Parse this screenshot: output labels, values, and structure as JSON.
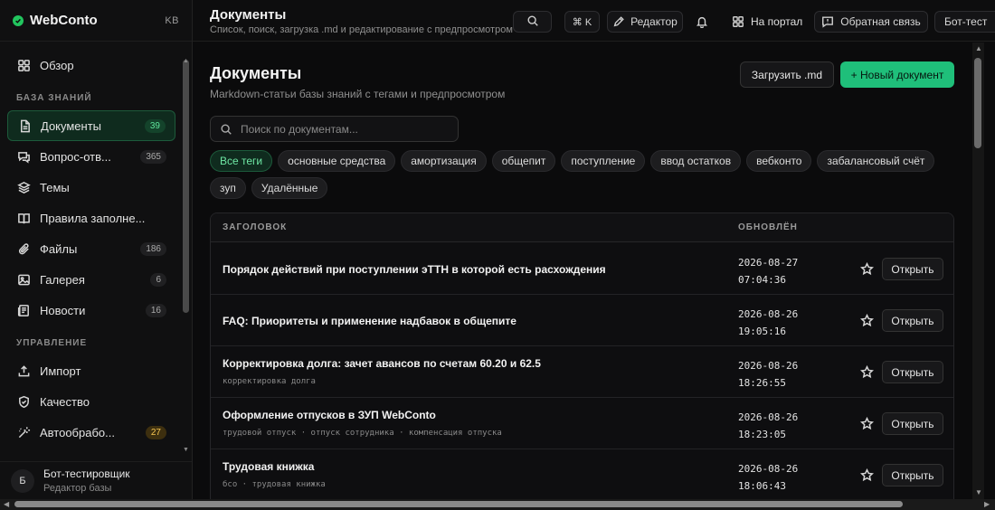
{
  "brand": {
    "name": "WebConto",
    "kb": "KB"
  },
  "sidebar": {
    "top": [
      {
        "label": "Обзор",
        "icon": "grid-icon"
      }
    ],
    "section_knowledge": "БАЗА ЗНАНИЙ",
    "knowledge": [
      {
        "label": "Документы",
        "badge": "39",
        "icon": "document-icon"
      },
      {
        "label": "Вопрос-отв...",
        "badge": "365",
        "icon": "chat-icon"
      },
      {
        "label": "Темы",
        "badge": "",
        "icon": "layers-icon"
      },
      {
        "label": "Правила заполне...",
        "badge": "",
        "icon": "book-icon"
      },
      {
        "label": "Файлы",
        "badge": "186",
        "icon": "paperclip-icon"
      },
      {
        "label": "Галерея",
        "badge": "6",
        "icon": "image-icon"
      },
      {
        "label": "Новости",
        "badge": "16",
        "icon": "newspaper-icon"
      }
    ],
    "section_manage": "УПРАВЛЕНИЕ",
    "manage": [
      {
        "label": "Импорт",
        "badge": "",
        "icon": "upload-icon"
      },
      {
        "label": "Качество",
        "badge": "",
        "icon": "shield-icon"
      },
      {
        "label": "Автообрабо...",
        "badge": "27",
        "icon": "wand-icon"
      }
    ]
  },
  "user": {
    "initial": "Б",
    "name": "Бот-тестировщик",
    "role": "Редактор базы"
  },
  "topbar": {
    "title": "Документы",
    "subtitle": "Список, поиск, загрузка .md и редактирование с предпросмотром",
    "shortcut": "⌘ K",
    "editor": "Редактор",
    "portal": "На портал",
    "feedback": "Обратная связь",
    "bot": "Бот-тест"
  },
  "page": {
    "title": "Документы",
    "subtitle": "Markdown-статьи базы знаний с тегами и предпросмотром",
    "upload": "Загрузить .md",
    "new": "+ Новый документ",
    "search_placeholder": "Поиск по документам..."
  },
  "tags": [
    "Все теги",
    "основные средства",
    "амортизация",
    "общепит",
    "поступление",
    "ввод остатков",
    "вебконто",
    "забалансовый счёт",
    "зуп",
    "Удалённые"
  ],
  "table": {
    "headers": {
      "title": "ЗАГОЛОВОК",
      "updated": "ОБНОВЛЁН"
    },
    "open_label": "Открыть",
    "rows": [
      {
        "title": "Порядок действий при поступлении эТТН в которой есть расхождения",
        "tags": "",
        "date": "2026-08-27",
        "time": "07:04:36"
      },
      {
        "title": "FAQ: Приоритеты и применение надбавок в общепите",
        "tags": "",
        "date": "2026-08-26",
        "time": "19:05:16"
      },
      {
        "title": "Корректировка долга: зачет авансов по счетам 60.20 и 62.5",
        "tags": "корректировка долга",
        "date": "2026-08-26",
        "time": "18:26:55"
      },
      {
        "title": "Оформление отпусков в ЗУП WebConto",
        "tags": "трудовой отпуск · отпуск сотрудника · компенсация отпуска",
        "date": "2026-08-26",
        "time": "18:23:05"
      },
      {
        "title": "Трудовая книжка",
        "tags": "бсо · трудовая книжка",
        "date": "2026-08-26",
        "time": "18:06:43"
      }
    ]
  },
  "colors": {
    "accent": "#1fbf7a",
    "background": "#0b0b0c"
  }
}
